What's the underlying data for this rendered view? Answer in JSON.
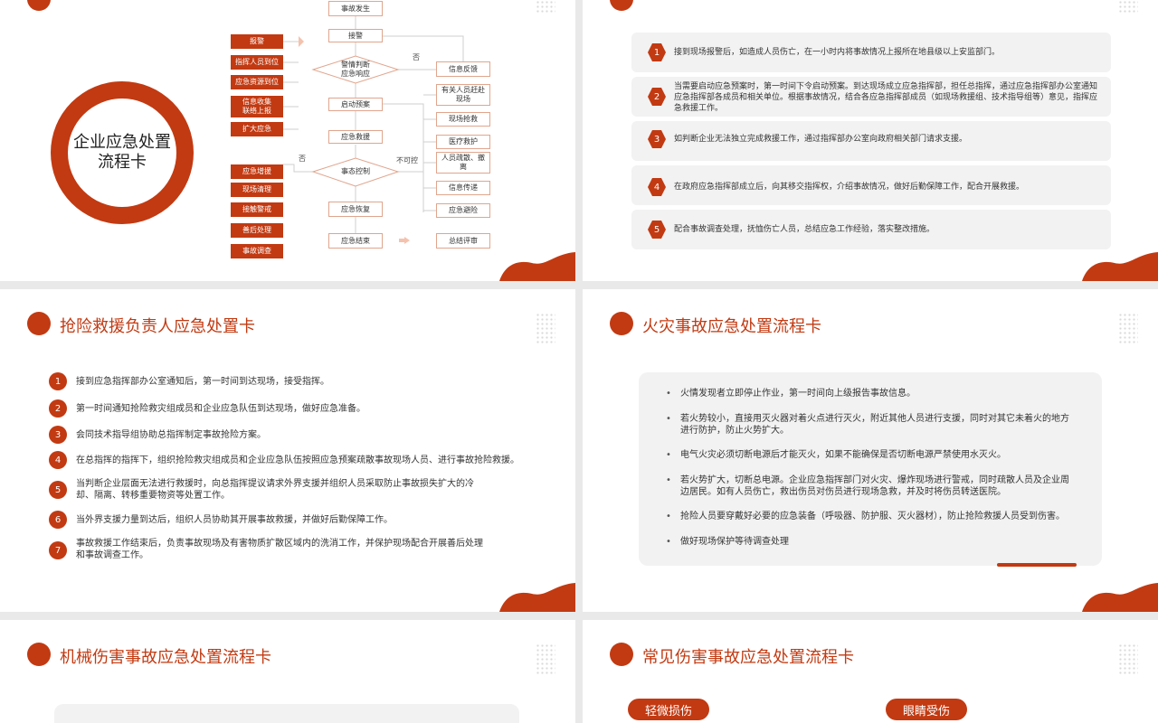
{
  "slide1": {
    "ring_title": "企业应急处置流程卡",
    "left_boxes": [
      "报警",
      "指挥人员到位",
      "应急资源到位",
      "信息收集\n联络上报",
      "扩大应急",
      "应急增援",
      "现场清理",
      "接触警戒",
      "善后处理",
      "事故调查"
    ],
    "flow_boxes": [
      "事故发生",
      "接警",
      "启动预案",
      "应急救援",
      "应急恢复",
      "应急结束"
    ],
    "diamonds": [
      "警情判断\n应急响应",
      "事态控制"
    ],
    "right_boxes": [
      "信息反馈",
      "有关人员赶赴\n现场",
      "现场抢救",
      "医疗救护",
      "人员疏散、撤\n离",
      "信息传递",
      "应急避险",
      "总结评审"
    ],
    "label_no_1": "否",
    "label_no_2": "否",
    "label_uncontrollable": "不可控"
  },
  "slide2": {
    "items": [
      {
        "num": "1",
        "text": "接到现场报警后，如造成人员伤亡，在一小时内将事故情况上报所在地县级以上安监部门。"
      },
      {
        "num": "2",
        "text": "当需要启动应急预案时，第一时间下令启动预案。到达现场成立应急指挥部，担任总指挥，通过应急指挥部办公室通知应急指挥部各成员和相关单位。根据事故情况，结合各应急指挥部成员（如现场救援组、技术指导组等）意见，指挥应急救援工作。"
      },
      {
        "num": "3",
        "text": "如判断企业无法独立完成救援工作，通过指挥部办公室向政府相关部门请求支援。"
      },
      {
        "num": "4",
        "text": "在政府应急指挥部成立后，向其移交指挥权，介绍事故情况，做好后勤保障工作，配合开展救援。"
      },
      {
        "num": "5",
        "text": "配合事故调查处理，抚恤伤亡人员，总结应急工作经验，落实整改措施。"
      }
    ]
  },
  "slide3": {
    "title": "抢险救援负责人应急处置卡",
    "items": [
      {
        "num": "1",
        "text": "接到应急指挥部办公室通知后，第一时间到达现场，接受指挥。"
      },
      {
        "num": "2",
        "text": "第一时间通知抢险救灾组成员和企业应急队伍到达现场，做好应急准备。"
      },
      {
        "num": "3",
        "text": "会同技术指导组协助总指挥制定事故抢险方案。"
      },
      {
        "num": "4",
        "text": "在总指挥的指挥下，组织抢险救灾组成员和企业应急队伍按照应急预案疏散事故现场人员、进行事故抢险救援。"
      },
      {
        "num": "5",
        "text": "当判断企业层面无法进行救援时，向总指挥提议请求外界支援并组织人员采取防止事故损失扩大的冷却、隔离、转移重要物资等处置工作。"
      },
      {
        "num": "6",
        "text": "当外界支援力量到达后，组织人员协助其开展事故救援，并做好后勤保障工作。"
      },
      {
        "num": "7",
        "text": "事故救援工作结束后，负责事故现场及有害物质扩散区域内的洗消工作，并保护现场配合开展善后处理和事故调查工作。"
      }
    ]
  },
  "slide4": {
    "title": "火灾事故应急处置流程卡",
    "items": [
      "火情发现者立即停止作业，第一时间向上级报告事故信息。",
      "若火势较小，直接用灭火器对着火点进行灭火，附近其他人员进行支援，同时对其它未着火的地方进行防护，防止火势扩大。",
      "电气火灾必须切断电源后才能灭火，如果不能确保是否切断电源严禁使用水灭火。",
      "若火势扩大，切断总电源。企业应急指挥部门对火灾、爆炸现场进行警戒，同时疏散人员及企业周边居民。如有人员伤亡，救出伤员对伤员进行现场急救，并及时将伤员转送医院。",
      "抢险人员要穿戴好必要的应急装备（呼吸器、防护服、灭火器材），防止抢险救援人员受到伤害。",
      "做好现场保护等待调查处理"
    ]
  },
  "slide5": {
    "title": "机械伤害事故应急处置流程卡"
  },
  "slide6": {
    "title": "常见伤害事故应急处置流程卡",
    "pill1": "轻微损伤",
    "pill2": "眼睛受伤"
  },
  "colors": {
    "accent": "#c23a12",
    "panel": "#f2f2f2"
  }
}
